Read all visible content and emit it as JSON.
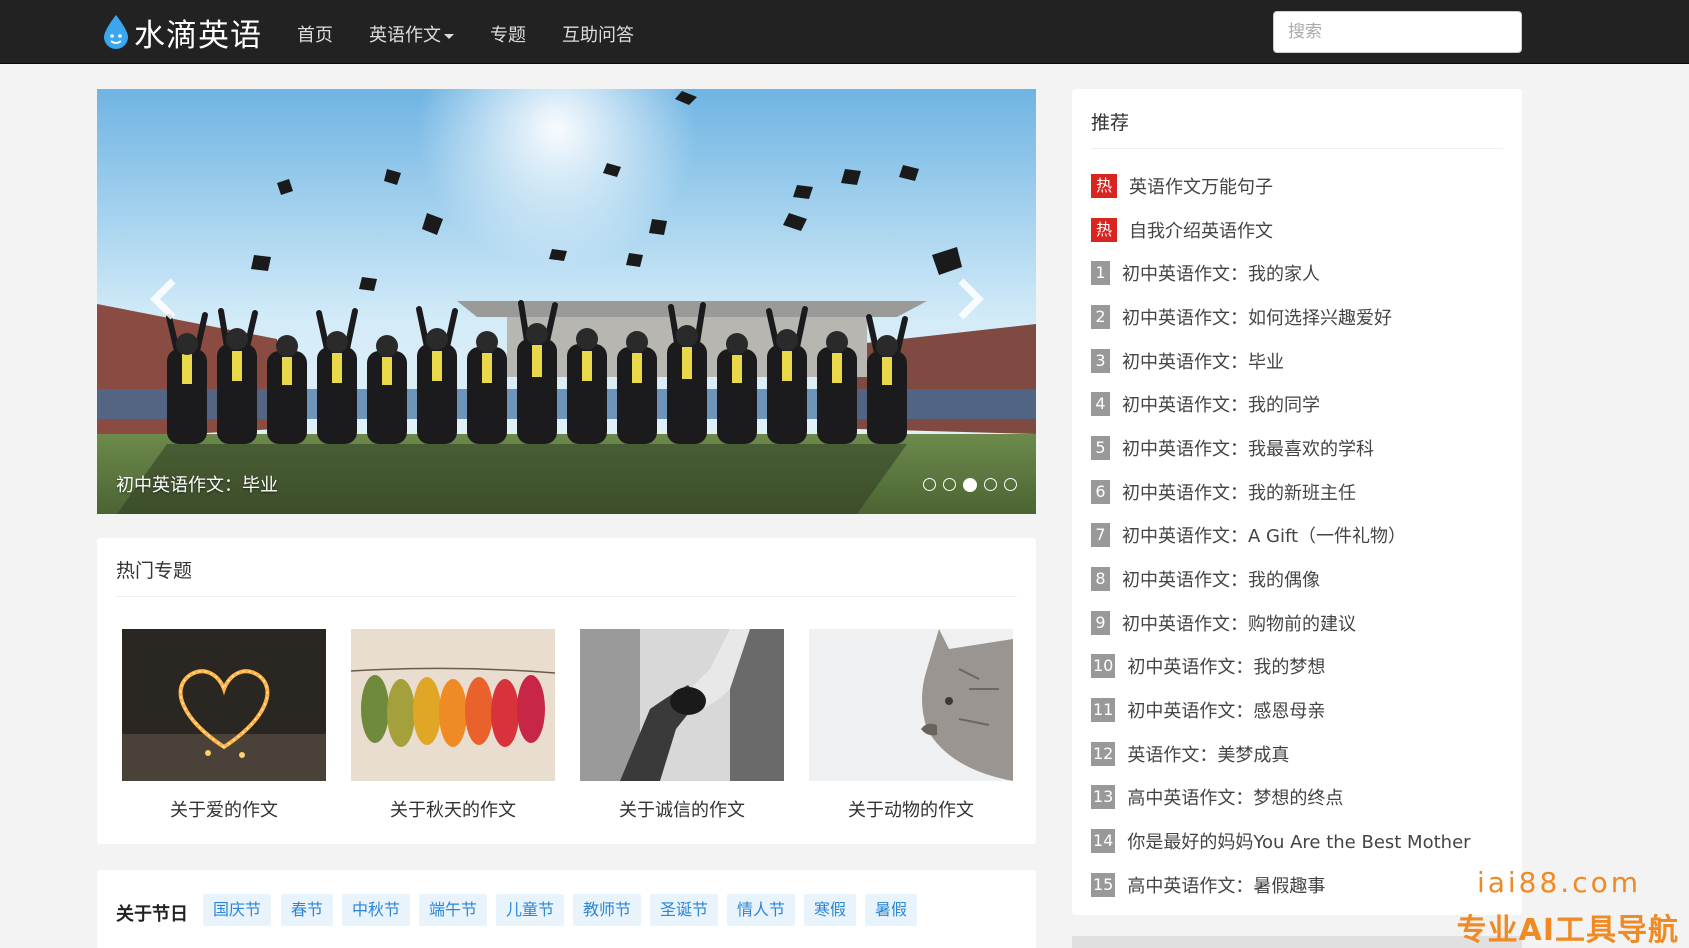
{
  "header": {
    "logo_text": "水滴英语",
    "nav": [
      {
        "label": "首页"
      },
      {
        "label": "英语作文"
      },
      {
        "label": "专题"
      },
      {
        "label": "互助问答"
      }
    ],
    "search_placeholder": "搜索"
  },
  "carousel": {
    "caption": "初中英语作文：毕业",
    "indicator_count": 5,
    "active_indicator": 3
  },
  "topics": {
    "title": "热门专题",
    "items": [
      {
        "label": "关于爱的作文",
        "image": "heart-lights"
      },
      {
        "label": "关于秋天的作文",
        "image": "autumn-leaves"
      },
      {
        "label": "关于诚信的作文",
        "image": "handshake"
      },
      {
        "label": "关于动物的作文",
        "image": "cat"
      }
    ]
  },
  "holidays": {
    "title": "关于节日",
    "tags": [
      "国庆节",
      "春节",
      "中秋节",
      "端午节",
      "儿童节",
      "教师节",
      "圣诞节",
      "情人节",
      "寒假",
      "暑假"
    ]
  },
  "recommend": {
    "title": "推荐",
    "items": [
      {
        "badge": "热",
        "text": "英语作文万能句子"
      },
      {
        "badge": "热",
        "text": "自我介绍英语作文"
      },
      {
        "badge": "1",
        "text": "初中英语作文：我的家人"
      },
      {
        "badge": "2",
        "text": "初中英语作文：如何选择兴趣爱好"
      },
      {
        "badge": "3",
        "text": "初中英语作文：毕业"
      },
      {
        "badge": "4",
        "text": "初中英语作文：我的同学"
      },
      {
        "badge": "5",
        "text": "初中英语作文：我最喜欢的学科"
      },
      {
        "badge": "6",
        "text": "初中英语作文：我的新班主任"
      },
      {
        "badge": "7",
        "text": "初中英语作文：A Gift（一件礼物）"
      },
      {
        "badge": "8",
        "text": "初中英语作文：我的偶像"
      },
      {
        "badge": "9",
        "text": "初中英语作文：购物前的建议"
      },
      {
        "badge": "10",
        "text": "初中英语作文：我的梦想"
      },
      {
        "badge": "11",
        "text": "初中英语作文：感恩母亲"
      },
      {
        "badge": "12",
        "text": "英语作文：美梦成真"
      },
      {
        "badge": "13",
        "text": "高中英语作文：梦想的终点"
      },
      {
        "badge": "14",
        "text": "你是最好的妈妈You Are the Best Mother"
      },
      {
        "badge": "15",
        "text": "高中英语作文：暑假趣事"
      }
    ]
  },
  "watermark": {
    "line1": "iai88.com",
    "line2": "专业AI工具导航"
  },
  "colors": {
    "navbar": "#222222",
    "hot_badge": "#d9241f",
    "tag_text": "#2b87d6",
    "watermark": "#f08a24"
  }
}
